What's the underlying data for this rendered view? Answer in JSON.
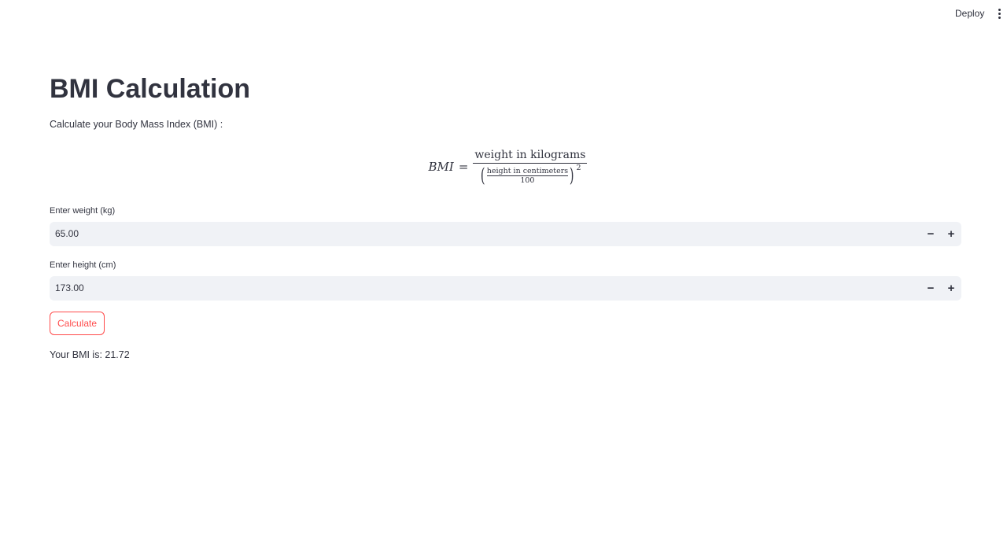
{
  "toolbar": {
    "deploy_label": "Deploy",
    "menu_icon": "kebab-menu-icon"
  },
  "page": {
    "title": "BMI Calculation",
    "subtitle": "Calculate your Body Mass Index (BMI) :"
  },
  "formula": {
    "lhs": "BMI",
    "equals": "=",
    "numerator": "weight in kilograms",
    "inner_numerator": "height in centimeters",
    "inner_denominator": "100",
    "exponent": "2",
    "left_paren": "(",
    "right_paren": ")"
  },
  "weight": {
    "label": "Enter weight (kg)",
    "value": "65.00",
    "minus": "−",
    "plus": "+"
  },
  "height": {
    "label": "Enter height (cm)",
    "value": "173.00",
    "minus": "−",
    "plus": "+"
  },
  "action": {
    "calculate_label": "Calculate"
  },
  "result": {
    "text": "Your BMI is: 21.72"
  },
  "colors": {
    "accent": "#ff4b4b",
    "input_bg": "#f0f2f6",
    "text": "#31333f"
  }
}
